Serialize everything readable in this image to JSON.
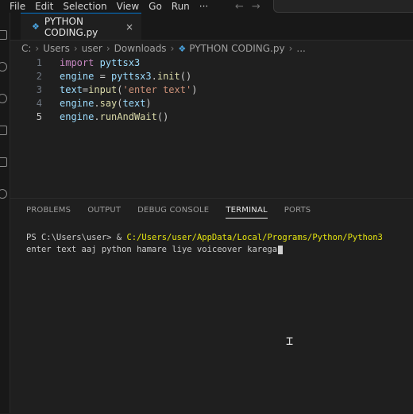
{
  "menu": [
    "File",
    "Edit",
    "Selection",
    "View",
    "Go",
    "Run",
    "···"
  ],
  "nav": {
    "back": "←",
    "forward": "→"
  },
  "tab": {
    "title": "PYTHON CODING.py",
    "icon": "python-file-icon",
    "close": "×"
  },
  "breadcrumb": [
    "C:",
    "Users",
    "user",
    "Downloads",
    "PYTHON CODING.py",
    "..."
  ],
  "code_lines": [
    {
      "n": "1",
      "text": "import pyttsx3"
    },
    {
      "n": "2",
      "text": "engine = pyttsx3.init()"
    },
    {
      "n": "3",
      "text": "text=input('enter text')"
    },
    {
      "n": "4",
      "text": "engine.say(text)"
    },
    {
      "n": "5",
      "text": "engine.runAndWait()"
    }
  ],
  "panel_tabs": [
    "PROBLEMS",
    "OUTPUT",
    "DEBUG CONSOLE",
    "TERMINAL",
    "PORTS"
  ],
  "terminal": {
    "prompt": "PS C:\\Users\\user> & ",
    "command_path": "C:/Users/user/AppData/Local/Programs/Python/Python3",
    "output": "enter text aaj python hamare liye voiceover karega"
  },
  "colors": {
    "accent": "#0078d4",
    "keyword": "#c586c0",
    "string": "#ce9178",
    "terminal_path": "#e5e510"
  }
}
